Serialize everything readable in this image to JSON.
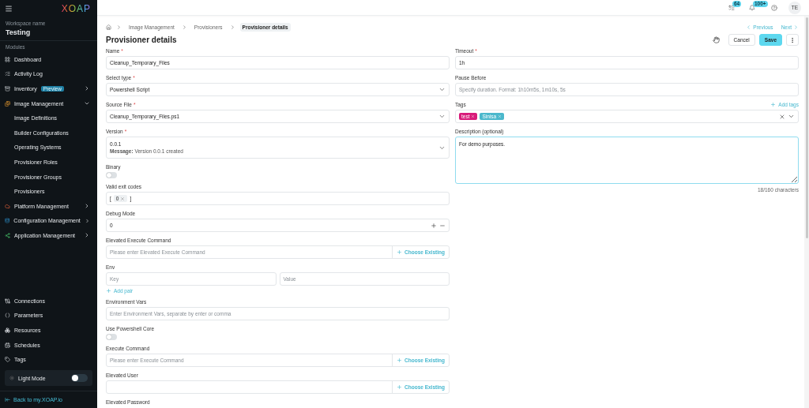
{
  "sidebar": {
    "logo": "XOAP",
    "workspace_label": "Workspace name",
    "workspace_name": "Testing",
    "section_label": "Modules",
    "items": [
      {
        "label": "Dashboard"
      },
      {
        "label": "Activity Log"
      },
      {
        "label": "Inventory",
        "badge": "Preview",
        "expanded": false
      },
      {
        "label": "Image Management",
        "expanded": true,
        "children": [
          {
            "label": "Image Definitions"
          },
          {
            "label": "Builder Configurations"
          },
          {
            "label": "Operating Systems"
          },
          {
            "label": "Provisioner Roles"
          },
          {
            "label": "Provisioner Groups"
          },
          {
            "label": "Provisioners"
          }
        ]
      },
      {
        "label": "Platform Management",
        "expanded": false
      },
      {
        "label": "Configuration Management",
        "expanded": false
      },
      {
        "label": "Application Management",
        "expanded": false
      }
    ],
    "bottom_items": [
      {
        "label": "Connections"
      },
      {
        "label": "Parameters"
      },
      {
        "label": "Resources"
      },
      {
        "label": "Schedules"
      },
      {
        "label": "Tags"
      }
    ],
    "light_mode": {
      "label": "Light Mode",
      "on": false
    },
    "back_link": "Back to my.XOAP.io"
  },
  "header": {
    "tasks_badge": "64",
    "notifications_badge": "100+",
    "avatar": "TE"
  },
  "breadcrumb": [
    {
      "label": "Image Management",
      "selected": false
    },
    {
      "label": "Provisioners",
      "selected": false
    },
    {
      "label": "Provisioner details",
      "selected": true
    }
  ],
  "pager": {
    "previous": "Previous",
    "next": "Next"
  },
  "title": "Provisioner details",
  "actions": {
    "cancel": "Cancel",
    "save": "Save"
  },
  "left_fields": [
    {
      "kind": "text",
      "label": "Name",
      "required_mark": "*",
      "value": "Cleanup_Temporary_Files"
    },
    {
      "kind": "select",
      "label": "Select type",
      "required_mark": "*",
      "value": "Powershell Script"
    },
    {
      "kind": "select",
      "label": "Source File",
      "required_mark": "*",
      "value": "Cleanup_Temporary_Files.ps1"
    },
    {
      "kind": "version",
      "label": "Version",
      "required_mark": "*",
      "value": "0.0.1",
      "message": "**Message:** Version 0.0.1 created"
    },
    {
      "kind": "toggle",
      "label": "Binary",
      "on": false
    },
    {
      "kind": "chips",
      "label": "Valid exit codes",
      "open": "[",
      "close": "]",
      "chips": [
        "0"
      ]
    },
    {
      "kind": "number",
      "label": "Debug Mode",
      "value": "0"
    },
    {
      "kind": "command",
      "label": "Elevated Execute Command",
      "placeholder": "Please enter Elevated Execute Command",
      "action": "Choose Existing"
    },
    {
      "kind": "pair",
      "label": "Env",
      "key_placeholder": "Key",
      "value_placeholder": "Value",
      "add": "Add pair"
    },
    {
      "kind": "text",
      "label": "Environment Vars",
      "placeholder": "Enter Environment Vars, separate by enter or comma"
    },
    {
      "kind": "toggle",
      "label": "Use Powershell Core",
      "on": false
    },
    {
      "kind": "command",
      "label": "Execute Command",
      "placeholder": "Please enter Execute Command",
      "action": "Choose Existing"
    },
    {
      "kind": "command",
      "label": "Elevated User",
      "action": "Choose Existing"
    },
    {
      "kind": "label",
      "label": "Elevated Password"
    }
  ],
  "right_fields": [
    {
      "kind": "text",
      "label": "Timeout",
      "required_mark": "*",
      "value": "1h"
    },
    {
      "kind": "text",
      "label": "Pause Before",
      "placeholder": "Specify duration. Format: 1h10m5s, 1m10s, 5s"
    },
    {
      "kind": "tags",
      "label": "Tags",
      "add": "Add tags",
      "tags": [
        {
          "label": "test",
          "color": "#d81b7a"
        },
        {
          "label": "Sinisa",
          "color": "#4bb8cc"
        }
      ]
    },
    {
      "kind": "textarea",
      "label": "Description (optional)",
      "value": "For demo purposes.",
      "counter": "18/160 characters"
    }
  ]
}
